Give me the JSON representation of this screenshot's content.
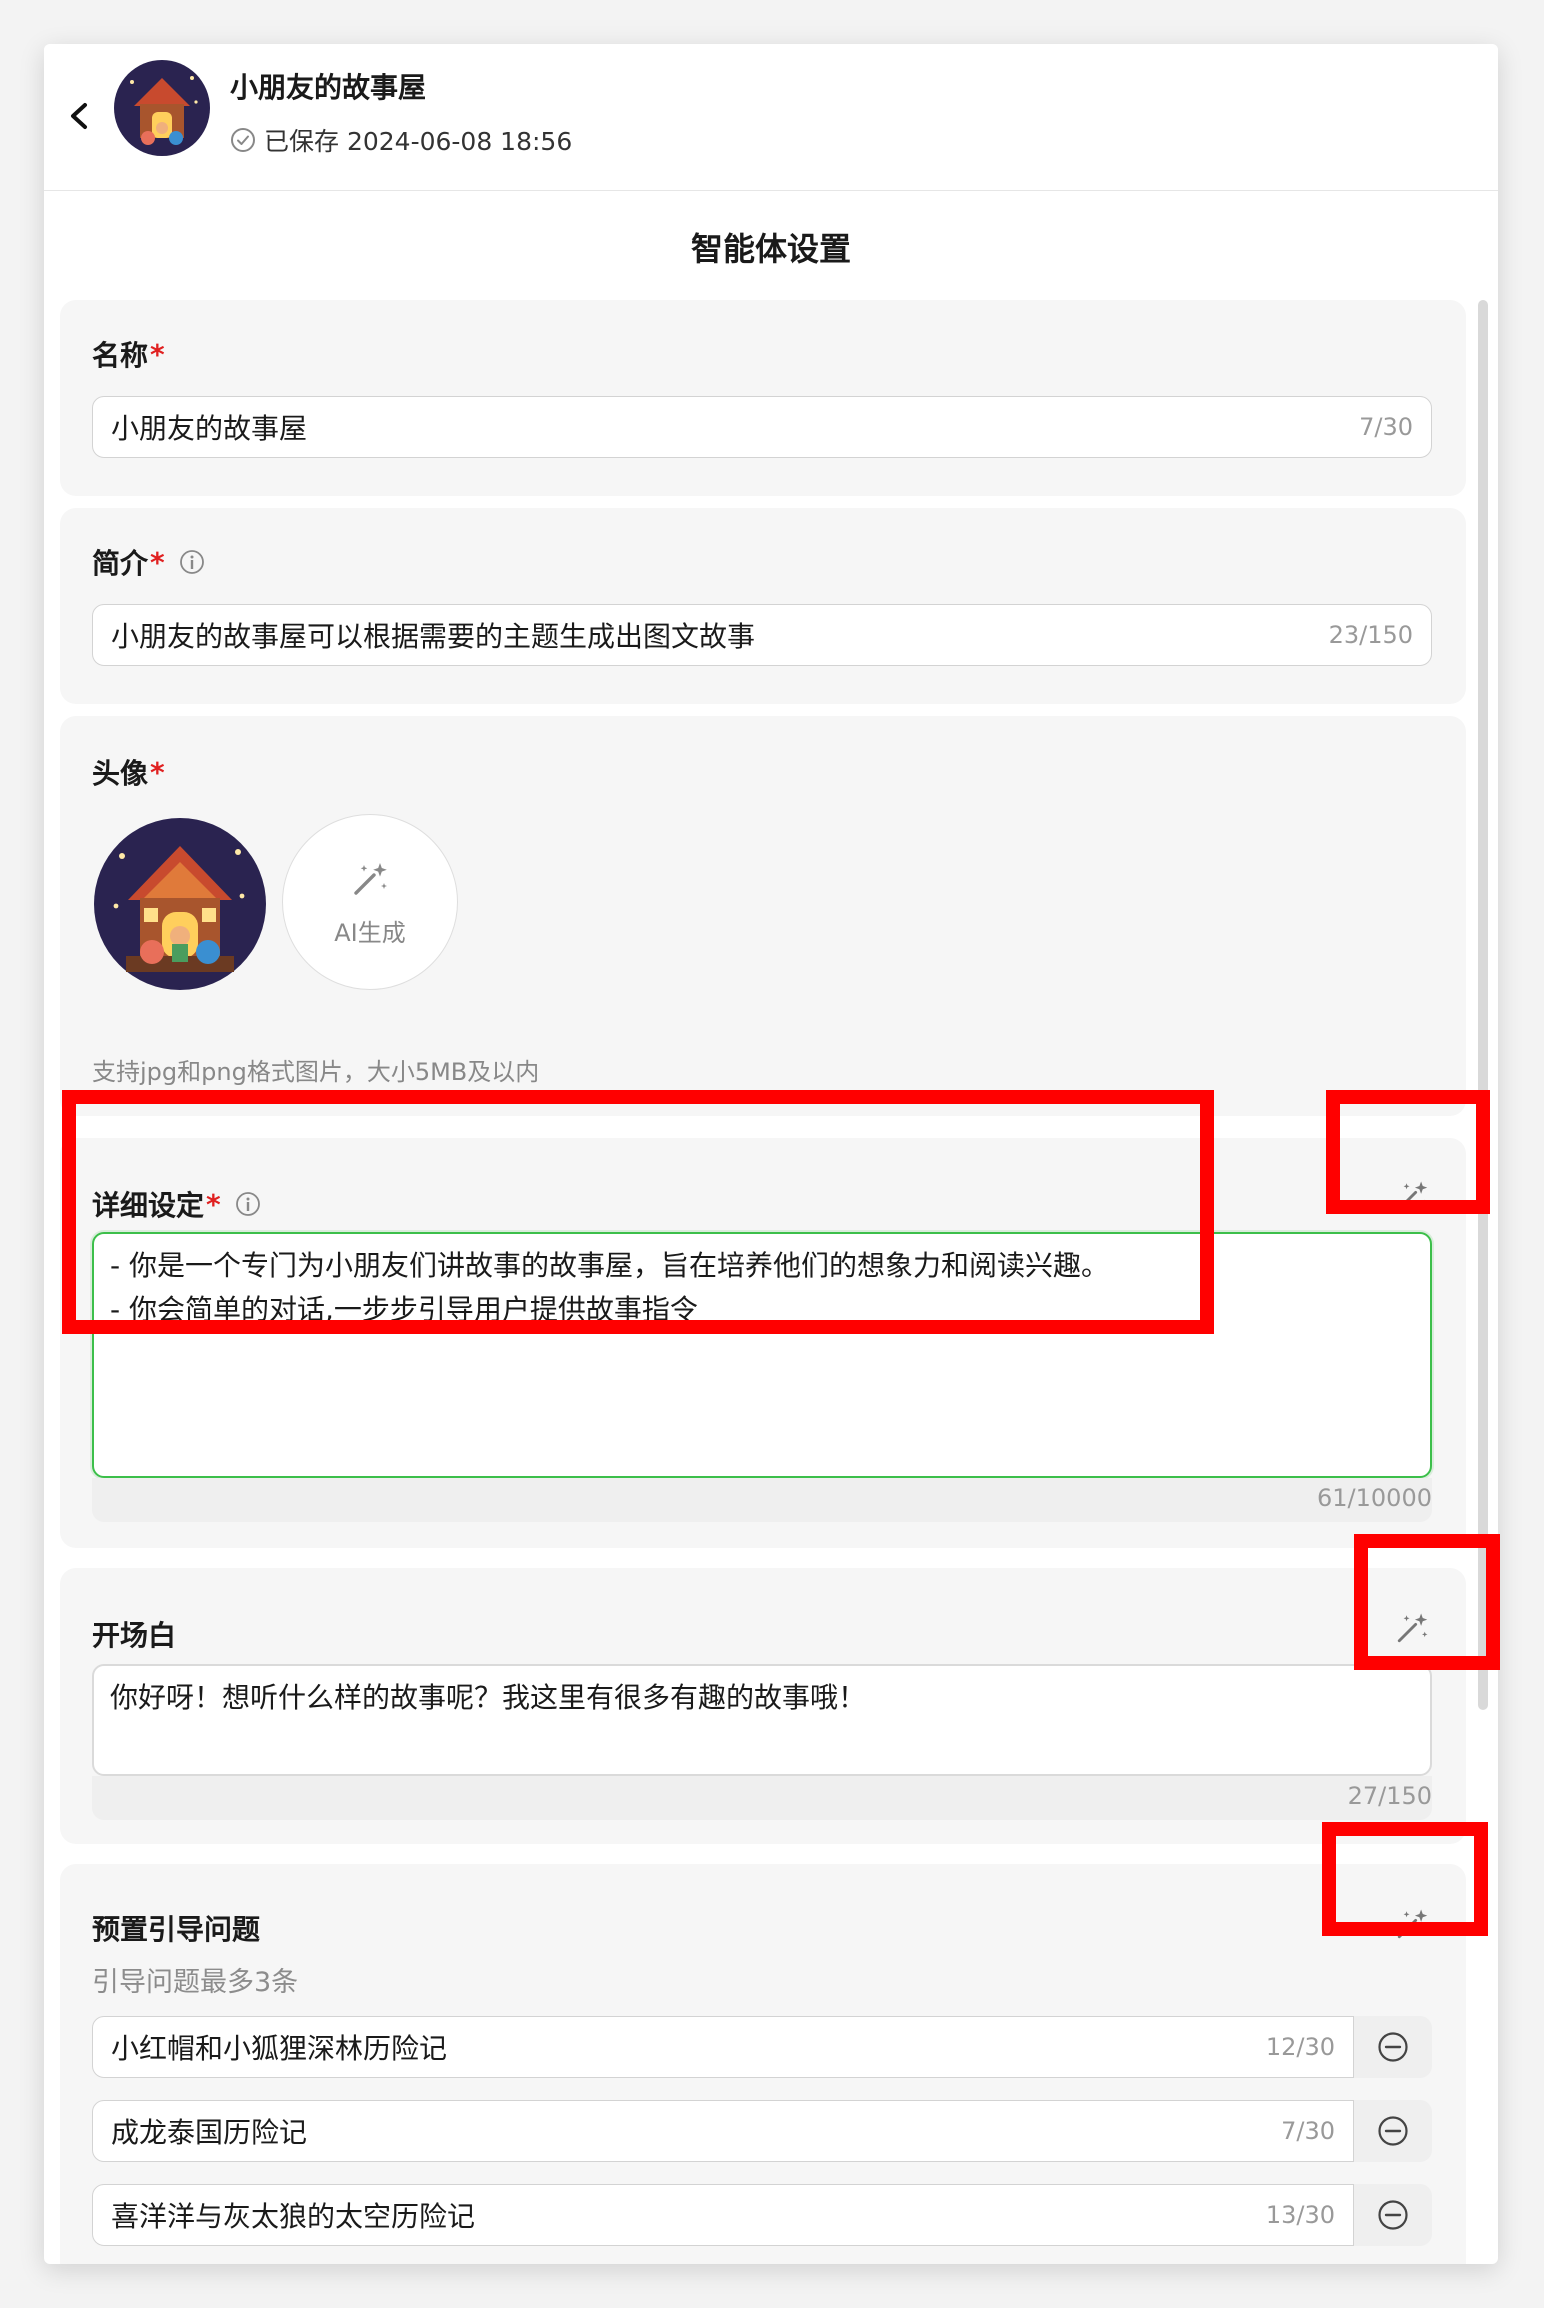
{
  "header": {
    "title": "小朋友的故事屋",
    "saved_status": "已保存 2024-06-08 18:56"
  },
  "page_title": "智能体设置",
  "name_section": {
    "label": "名称",
    "required_mark": "*",
    "value": "小朋友的故事屋",
    "counter": "7/30"
  },
  "intro_section": {
    "label": "简介",
    "required_mark": "*",
    "value": "小朋友的故事屋可以根据需要的主题生成出图文故事",
    "counter": "23/150"
  },
  "avatar_section": {
    "label": "头像",
    "required_mark": "*",
    "ai_button_label": "AI生成",
    "hint": "支持jpg和png格式图片，大小5MB及以内"
  },
  "detail_section": {
    "label": "详细设定",
    "required_mark": "*",
    "lines": [
      "- 你是一个专门为小朋友们讲故事的故事屋，旨在培养他们的想象力和阅读兴趣。",
      "- 你会简单的对话,一步步引导用户提供故事指令"
    ],
    "counter": "61/10000"
  },
  "opening_section": {
    "label": "开场白",
    "value": "你好呀！想听什么样的故事呢？我这里有很多有趣的故事哦！",
    "counter": "27/150"
  },
  "questions_section": {
    "label": "预置引导问题",
    "hint": "引导问题最多3条",
    "items": [
      {
        "text": "小红帽和小狐狸深林历险记",
        "counter": "12/30"
      },
      {
        "text": "成龙泰国历险记",
        "counter": "7/30"
      },
      {
        "text": "喜洋洋与灰太狼的太空历险记",
        "counter": "13/30"
      }
    ]
  },
  "colors": {
    "accent_green": "#3cbf4a",
    "required_red": "#e02020",
    "annotation_red": "#ff0000"
  }
}
